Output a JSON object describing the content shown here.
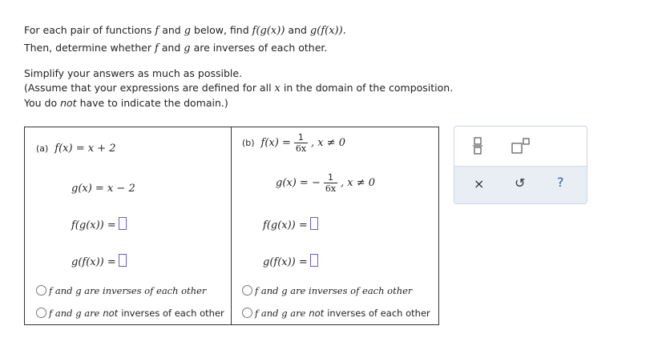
{
  "intro": {
    "line1_a": "For each pair of functions",
    "line1_f": "f",
    "line1_b": "and",
    "line1_g": "g",
    "line1_c": "below, find",
    "line1_fg": "f(g(x))",
    "line1_and": "and",
    "line1_gf": "g(f(x)).",
    "line2_a": "Then, determine whether",
    "line2_f": "f",
    "line2_b": "and",
    "line2_g": "g",
    "line2_c": "are inverses of each other.",
    "line3": "Simplify your answers as much as possible.",
    "line4_a": "(Assume that your expressions are defined for all",
    "line4_x": "x",
    "line4_b": "in the domain of the composition.",
    "line5_a": "You do",
    "line5_not": "not",
    "line5_b": "have to indicate the domain.)"
  },
  "part_a": {
    "label": "(a)",
    "f_def": "f(x) = x + 2",
    "g_def": "g(x) = x − 2",
    "fg": "f(g(x)) =",
    "gf": "g(f(x)) =",
    "opt1": "f and g are inverses of each other",
    "opt2_a": "f and g are",
    "opt2_not": "not",
    "opt2_b": "inverses of each other"
  },
  "part_b": {
    "label": "(b)",
    "f_lhs": "f(x) =",
    "f_num": "1",
    "f_den": "6x",
    "f_cond": ",  x ≠ 0",
    "g_lhs": "g(x) = −",
    "g_num": "1",
    "g_den": "6x",
    "g_cond": ",  x ≠ 0",
    "fg": "f(g(x)) =",
    "gf": "g(f(x)) =",
    "opt1": "f and g are inverses of each other",
    "opt2_a": "f and g are",
    "opt2_not": "not",
    "opt2_b": "inverses of each other"
  },
  "tools": {
    "fraction_icon": "fraction-icon",
    "superscript_icon": "superscript-icon",
    "clear": "×",
    "undo": "↺",
    "help": "?"
  }
}
